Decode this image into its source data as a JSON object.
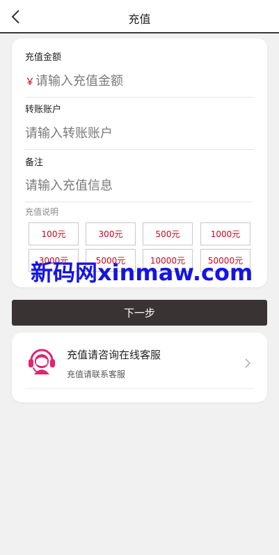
{
  "header": {
    "title": "充值",
    "back_icon": "chevron-left-icon"
  },
  "form": {
    "amount_label": "充值金额",
    "currency_symbol": "￥",
    "amount_placeholder": "请输入充值金额",
    "account_label": "转账账户",
    "account_placeholder": "请输入转账账户",
    "remark_label": "备注",
    "remark_placeholder": "请输入充值信息",
    "desc_label": "充值说明",
    "amounts": [
      "100元",
      "300元",
      "500元",
      "1000元",
      "3000元",
      "5000元",
      "10000元",
      "50000元"
    ]
  },
  "watermark": "新码网xinmaw.com",
  "next_button": "下一步",
  "service": {
    "title": "充值请咨询在线客服",
    "subtitle": "充值请联系客服",
    "icon": "customer-service-icon",
    "arrow_icon": "chevron-right-icon"
  },
  "colors": {
    "accent_red": "#d0021b",
    "button_dark": "#393333",
    "icon_pink": "#e2236f",
    "watermark_blue": "#1414e6"
  }
}
